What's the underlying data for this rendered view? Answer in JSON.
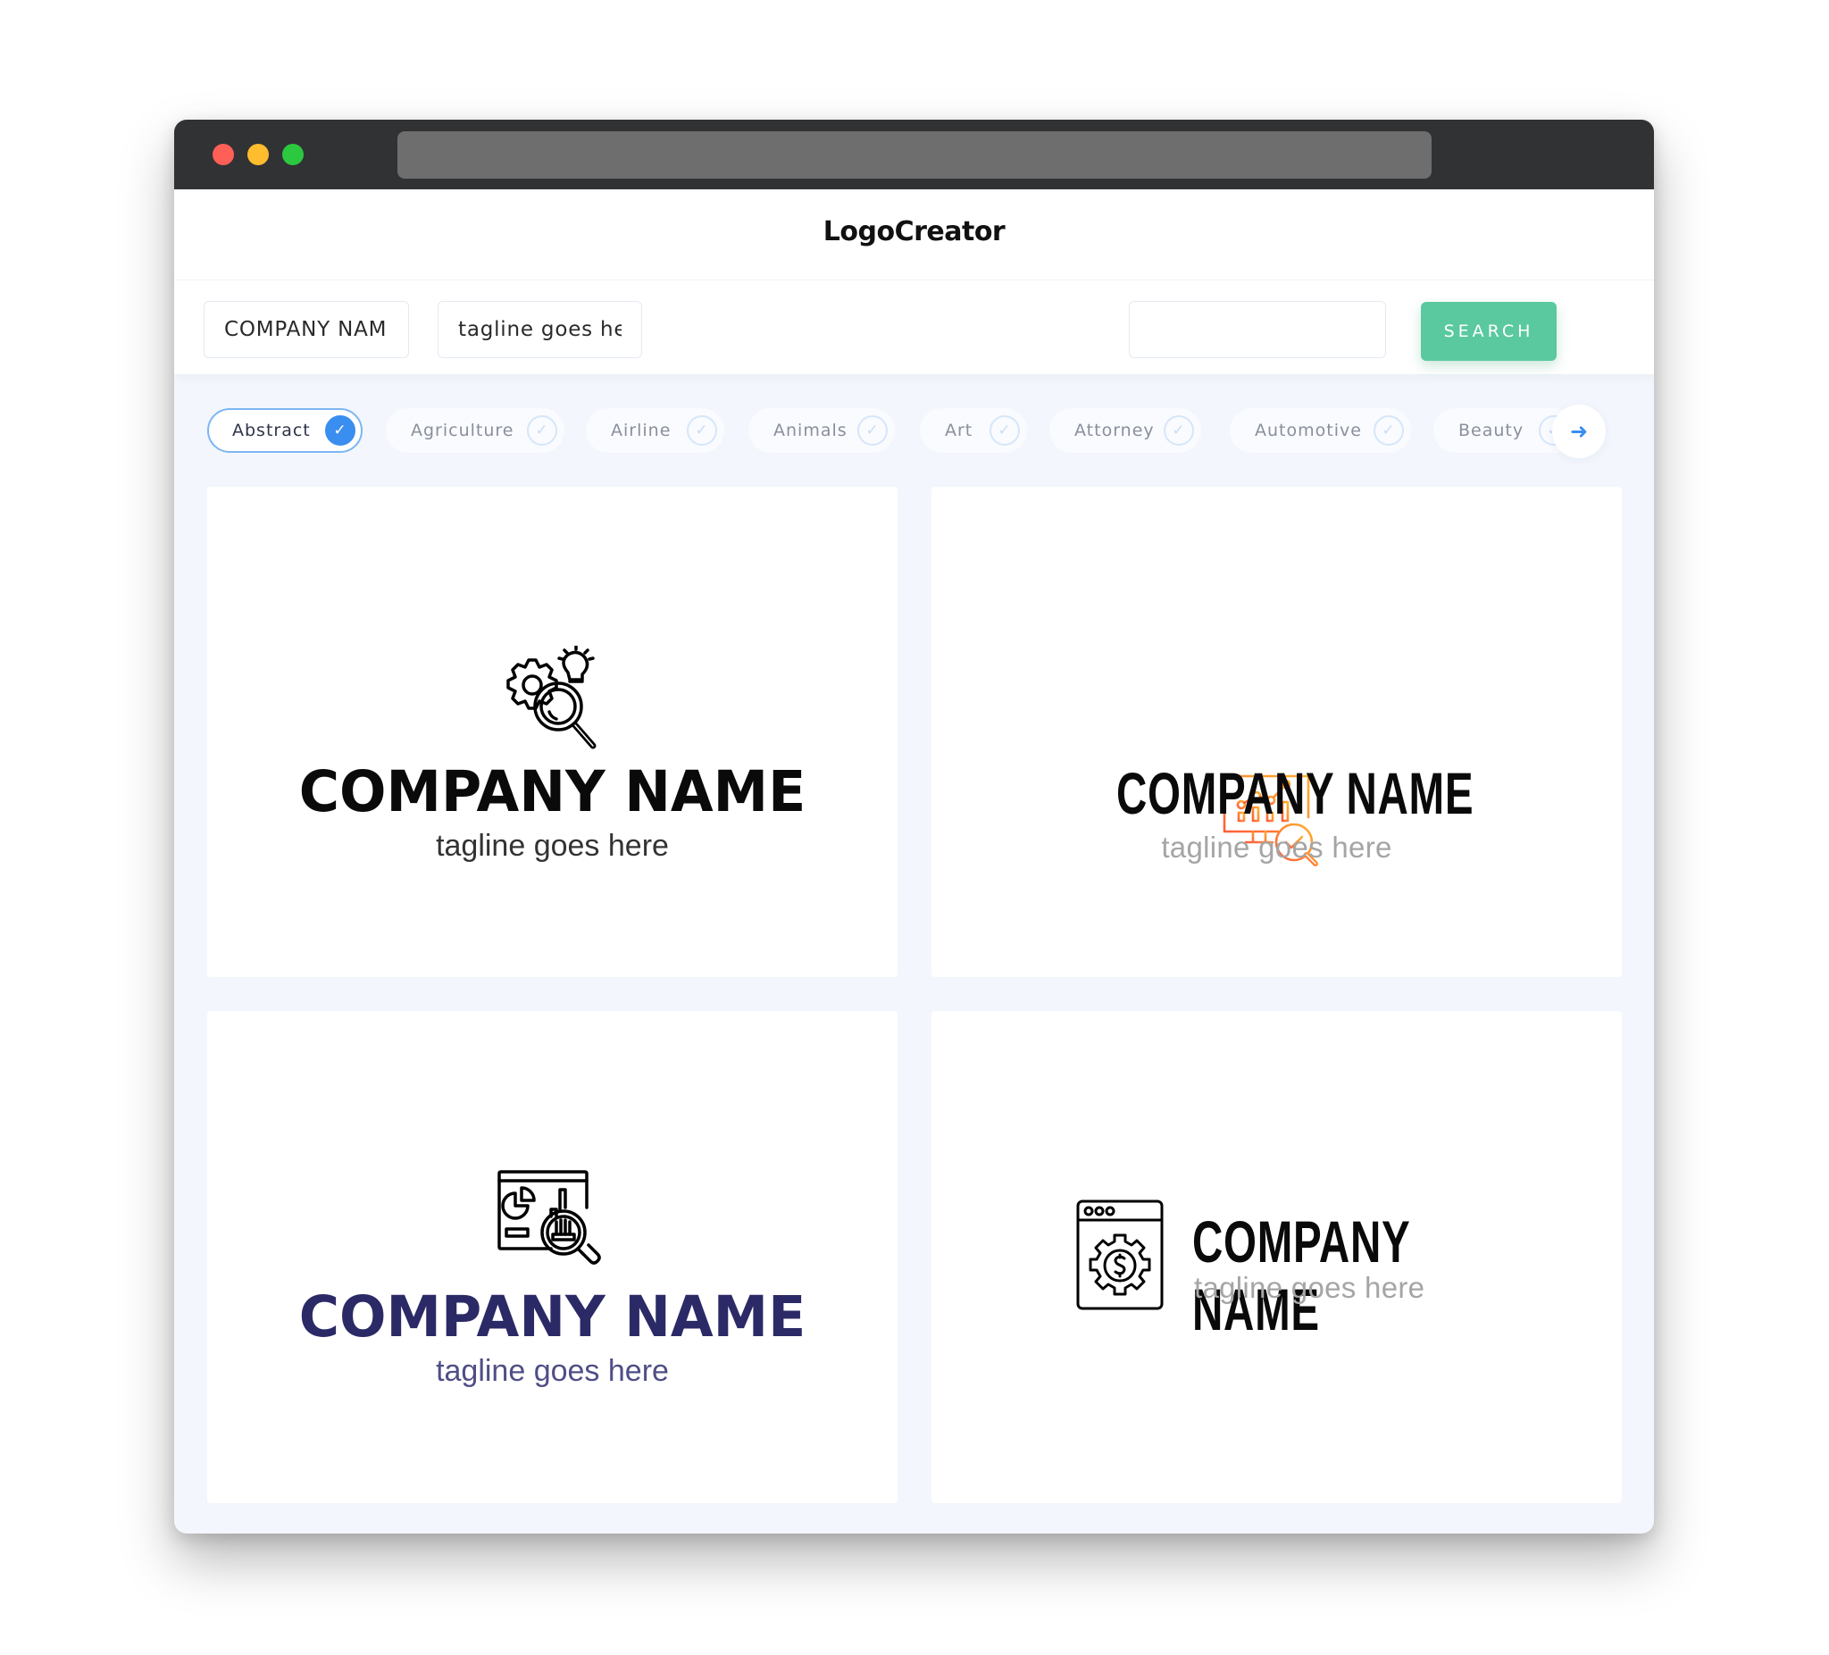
{
  "browser": {
    "traffic_lights": [
      "close",
      "minimize",
      "zoom"
    ],
    "url": ""
  },
  "header": {
    "title": "LogoCreator"
  },
  "search": {
    "company_value": "COMPANY NAME",
    "tagline_value": "tagline goes here",
    "query_value": "",
    "button_label": "SEARCH"
  },
  "categories": {
    "items": [
      {
        "label": "Abstract",
        "selected": true
      },
      {
        "label": "Agriculture",
        "selected": false
      },
      {
        "label": "Airline",
        "selected": false
      },
      {
        "label": "Animals",
        "selected": false
      },
      {
        "label": "Art",
        "selected": false
      },
      {
        "label": "Attorney",
        "selected": false
      },
      {
        "label": "Automotive",
        "selected": false
      },
      {
        "label": "Beauty",
        "selected": false
      }
    ],
    "next_icon": "arrow-right-icon"
  },
  "logos": [
    {
      "company": "COMPANY NAME",
      "tagline": "tagline goes here",
      "icon": "gear-bulb-magnifier-icon",
      "color": "#000000",
      "tagline_color": "#333333"
    },
    {
      "company": "COMPANY NAME",
      "tagline": "tagline goes here",
      "icon": "monitor-chart-magnifier-check-icon",
      "color": "#000000",
      "icon_gradient": [
        "#FF5F3A",
        "#FFB22E"
      ],
      "tagline_color": "#A5A5A5"
    },
    {
      "company": "COMPANY NAME",
      "tagline": "tagline goes here",
      "icon": "dashboard-magnifier-icon",
      "color": "#2B2A66",
      "tagline_color": "#4F4E86"
    },
    {
      "company": "COMPANY NAME",
      "tagline": "tagline goes here",
      "icon": "browser-gear-dollar-icon",
      "color": "#000000",
      "tagline_color": "#A5A5A5"
    }
  ],
  "colors": {
    "accent_green": "#5AC9A0",
    "accent_blue": "#3A8EF0",
    "titlebar": "#313234",
    "page_bg": "#F3F6FC"
  }
}
